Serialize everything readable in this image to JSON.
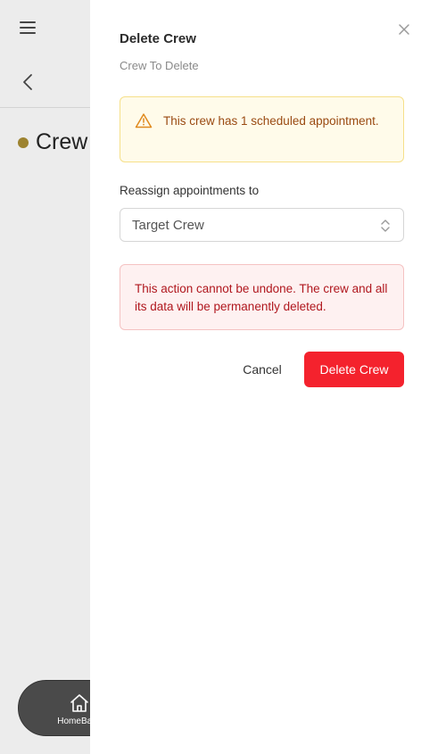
{
  "background": {
    "page_title": "Crew",
    "status_dot_color": "#9d8330",
    "home_label": "HomeBase"
  },
  "dialog": {
    "title": "Delete Crew",
    "subtitle": "Crew To Delete",
    "warning": "This crew has 1 scheduled appointment.",
    "reassign_label": "Reassign appointments to",
    "reassign_value": "Target Crew",
    "danger": "This action cannot be undone. The crew and all its data will be permanently deleted.",
    "cancel_label": "Cancel",
    "delete_label": "Delete Crew"
  },
  "colors": {
    "danger": "#f4222d",
    "warning_bg": "#fffbea",
    "danger_bg": "#fef1f1"
  }
}
